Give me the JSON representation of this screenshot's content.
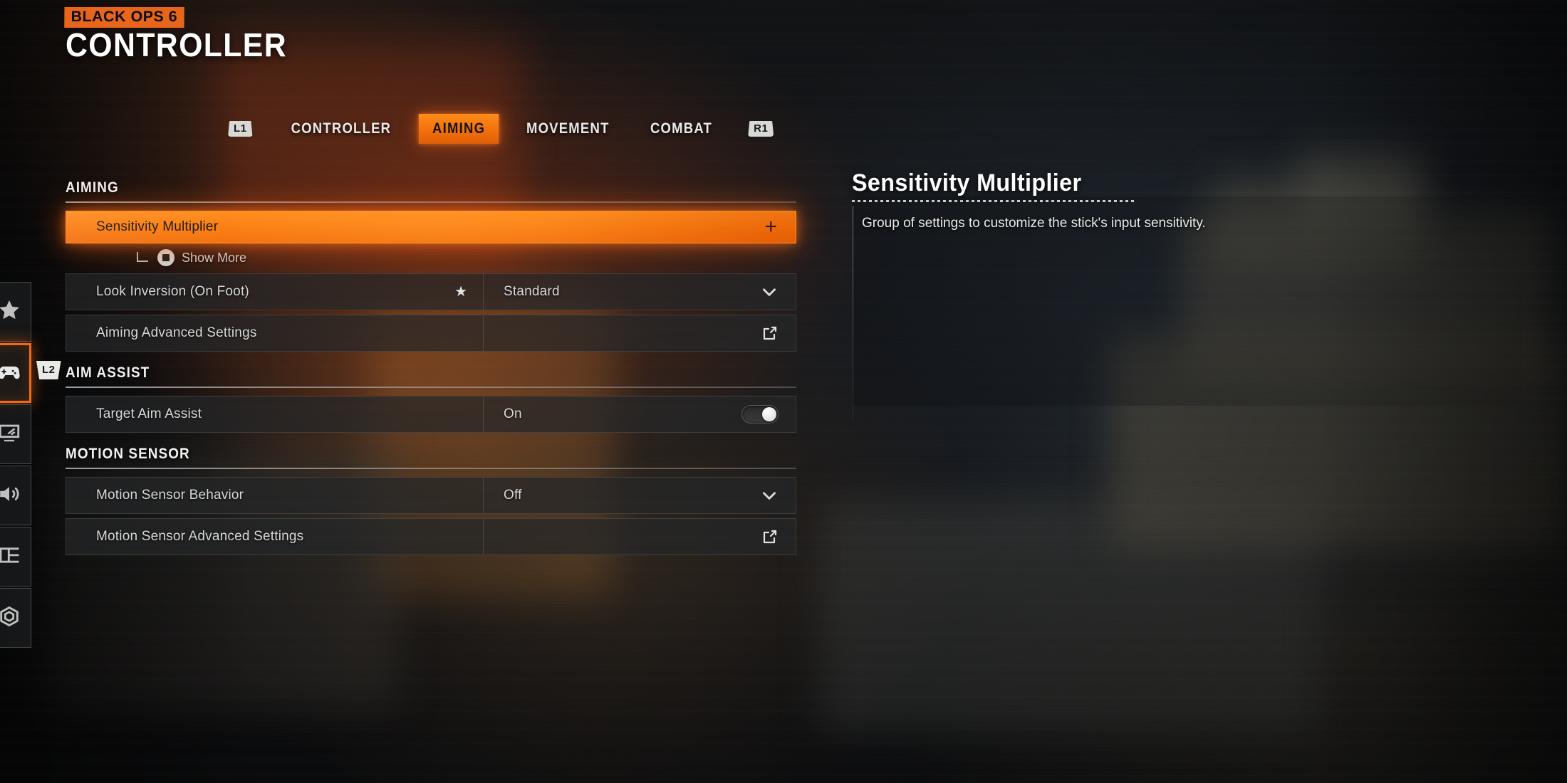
{
  "header": {
    "game_badge": "BLACK OPS 6",
    "title": "CONTROLLER"
  },
  "tabs": {
    "left_bumper": "L1",
    "right_bumper": "R1",
    "items": [
      {
        "label": "CONTROLLER",
        "active": false
      },
      {
        "label": "AIMING",
        "active": true
      },
      {
        "label": "MOVEMENT",
        "active": false
      },
      {
        "label": "COMBAT",
        "active": false
      }
    ]
  },
  "sidebar": {
    "trigger_tag": "L2",
    "items": [
      {
        "icon": "star-icon",
        "name": "favorites",
        "active": false
      },
      {
        "icon": "gamepad-icon",
        "name": "controller",
        "active": true
      },
      {
        "icon": "display-icon",
        "name": "graphics",
        "active": false
      },
      {
        "icon": "speaker-icon",
        "name": "audio",
        "active": false
      },
      {
        "icon": "interface-icon",
        "name": "interface",
        "active": false
      },
      {
        "icon": "account-icon",
        "name": "account-network",
        "active": false
      }
    ]
  },
  "settings": {
    "sections": [
      {
        "heading": "AIMING",
        "rows": [
          {
            "type": "selected",
            "label": "Sensitivity Multiplier",
            "action_icon": "plus-icon",
            "sub": {
              "label": "Show More",
              "button_icon": "square-button-icon"
            }
          },
          {
            "type": "dropdown",
            "label": "Look Inversion (On Foot)",
            "favorite_icon": "star-icon",
            "value": "Standard",
            "action_icon": "chevron-down-icon"
          },
          {
            "type": "link",
            "label": "Aiming Advanced Settings",
            "value": "",
            "action_icon": "external-link-icon"
          }
        ]
      },
      {
        "heading": "AIM ASSIST",
        "rows": [
          {
            "type": "toggle",
            "label": "Target Aim Assist",
            "value": "On",
            "action_icon": "toggle-switch-on"
          }
        ]
      },
      {
        "heading": "MOTION SENSOR",
        "rows": [
          {
            "type": "dropdown",
            "label": "Motion Sensor Behavior",
            "value": "Off",
            "action_icon": "chevron-down-icon"
          },
          {
            "type": "link",
            "label": "Motion Sensor Advanced Settings",
            "value": "",
            "action_icon": "external-link-icon"
          }
        ]
      }
    ]
  },
  "info": {
    "title": "Sensitivity Multiplier",
    "description": "Group of settings to customize the stick's input sensitivity."
  },
  "colors": {
    "accent_orange": "#f2700d",
    "badge_orange": "#e8661b",
    "row_bg": "rgba(36,37,39,.72)",
    "text_primary": "#d8d8d8"
  }
}
